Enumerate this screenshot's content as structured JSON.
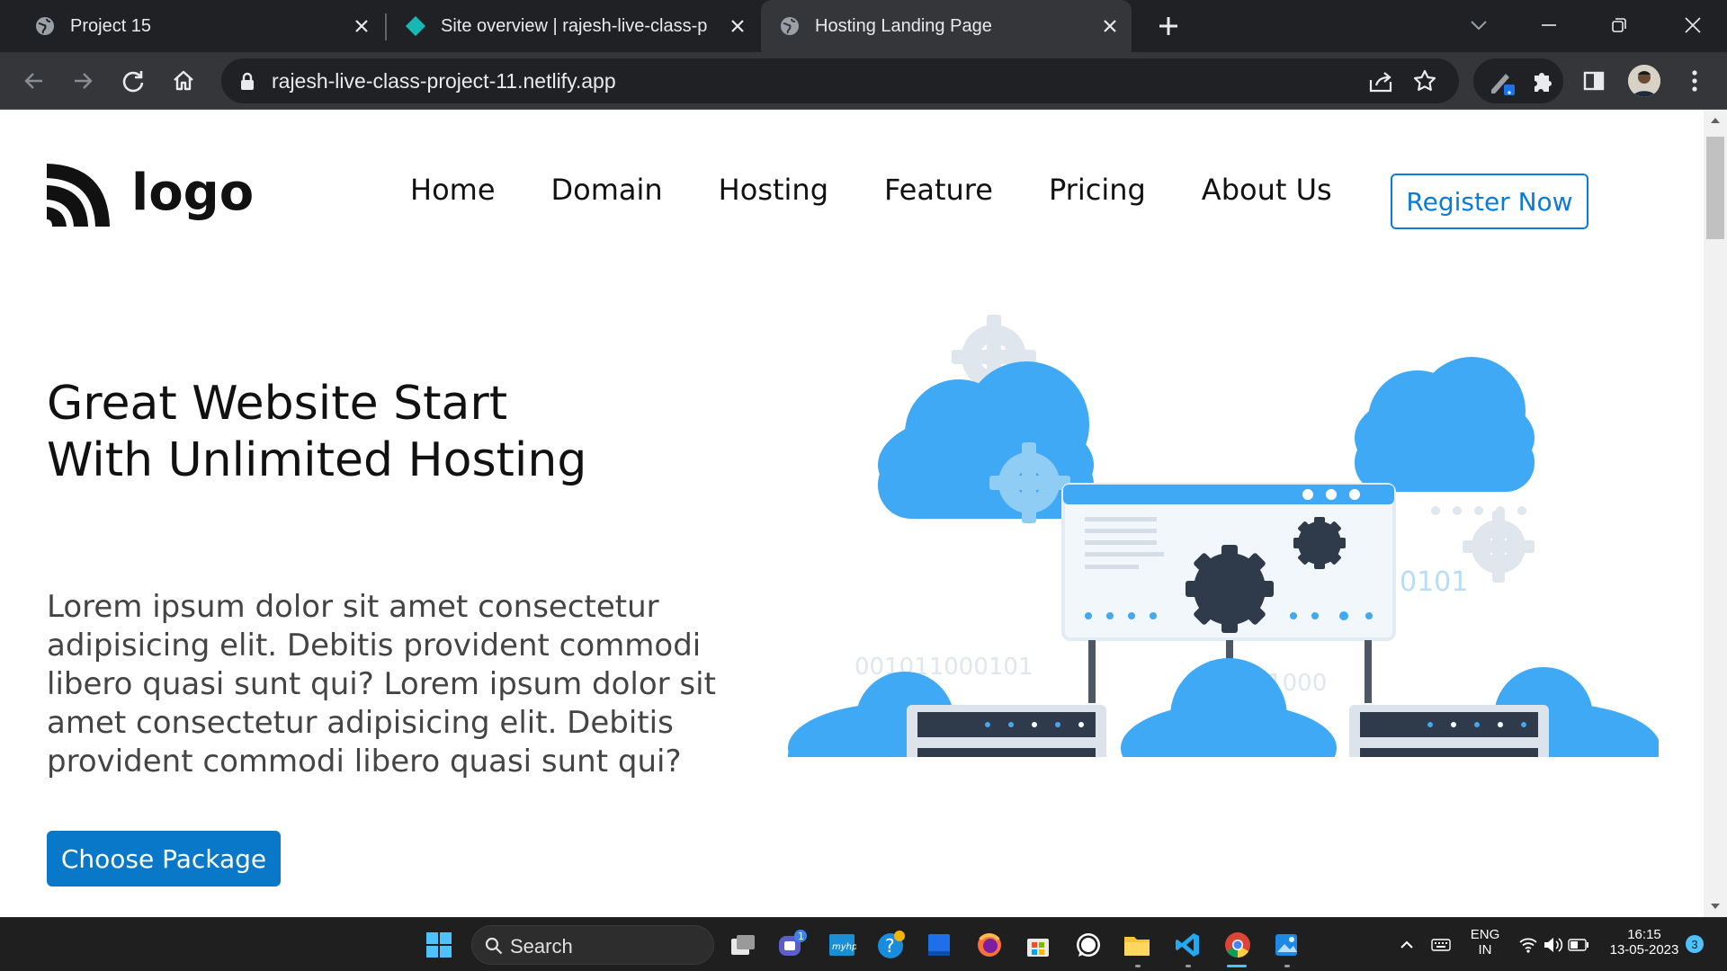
{
  "browser": {
    "tabs": [
      {
        "title": "Project 15",
        "active": false
      },
      {
        "title": "Site overview | rajesh-live-class-p",
        "active": false
      },
      {
        "title": "Hosting Landing Page",
        "active": true
      }
    ],
    "url": "rajesh-live-class-project-11.netlify.app"
  },
  "site": {
    "logo_text": "logo",
    "nav": [
      "Home",
      "Domain",
      "Hosting",
      "Feature",
      "Pricing",
      "About Us"
    ],
    "register_label": "Register Now",
    "hero": {
      "title": "Great Website Start With Unlimited Hosting",
      "text": "Lorem ipsum dolor sit amet consectetur adipisicing elit. Debitis provident commodi libero quasi sunt qui? Lorem ipsum dolor sit amet consectetur adipisicing elit. Debitis provident commodi libero quasi sunt qui?",
      "cta_label": "Choose Package"
    },
    "illustration_text": {
      "binary_1": "0101",
      "binary_2": "001011000101",
      "binary_3": "011000",
      "binary_4": "0010101"
    },
    "colors": {
      "accent": "#0a78c8",
      "cloud": "#3fa9f5",
      "cloud_light": "#cfe6f8"
    }
  },
  "taskbar": {
    "search_label": "Search",
    "language": "ENG",
    "region": "IN",
    "time": "16:15",
    "date": "13-05-2023",
    "notification_count": "3",
    "teams_badge": "1"
  }
}
